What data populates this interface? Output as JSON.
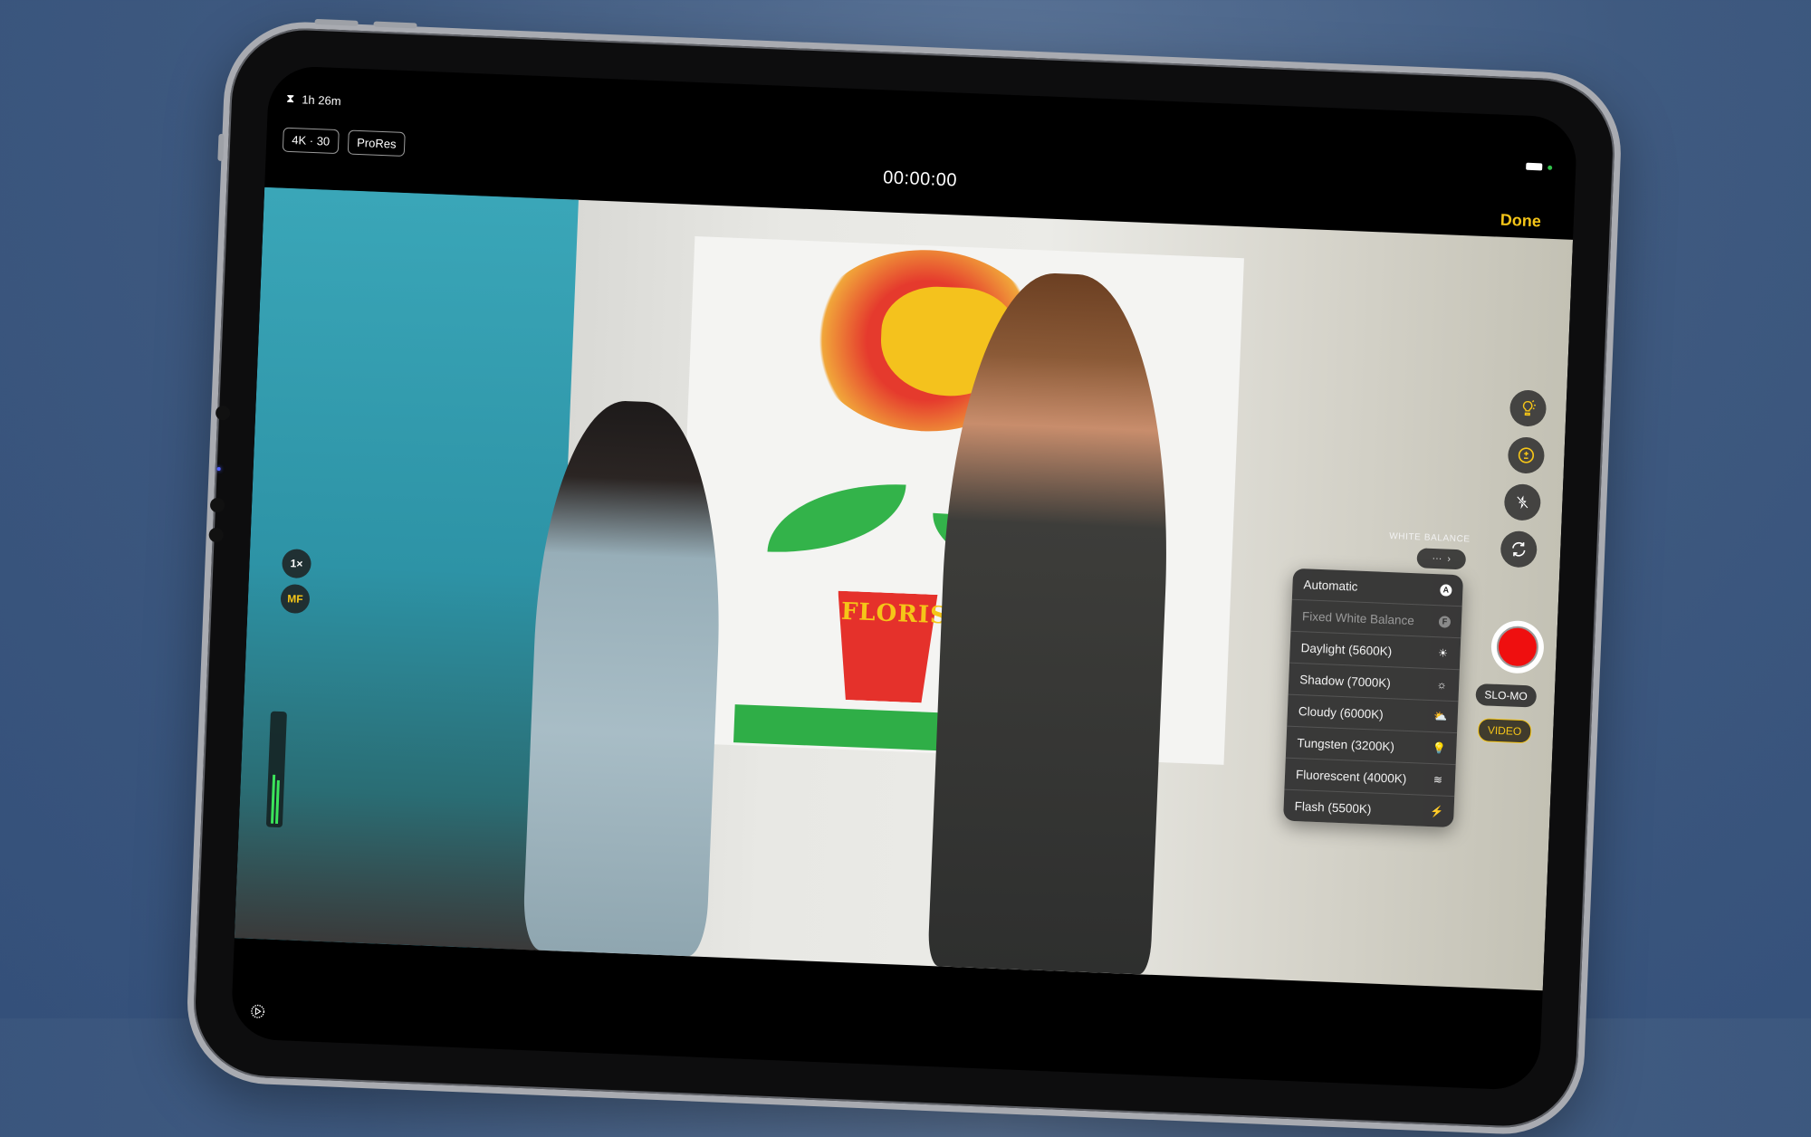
{
  "status": {
    "recording_time_remaining": "1h 26m",
    "hourglass_icon": "hourglass-icon"
  },
  "format_chips": [
    {
      "label": "4K · 30"
    },
    {
      "label": "ProRes"
    }
  ],
  "timer": "00:00:00",
  "done_label": "Done",
  "colors": {
    "accent": "#f5c518",
    "record": "#ef0f0f",
    "audio_meter": "#3be45a"
  },
  "left_controls": {
    "zoom_label": "1×",
    "focus_label": "MF"
  },
  "audio_meter": {
    "left_level": 0.45,
    "right_level": 0.4
  },
  "white_balance": {
    "title": "WHITE BALANCE",
    "button_label": "···",
    "options": [
      {
        "label": "Automatic",
        "icon": "badge-a-icon",
        "glyph": "A",
        "enabled": true
      },
      {
        "label": "Fixed White Balance",
        "icon": "badge-f-icon",
        "glyph": "F",
        "enabled": false
      },
      {
        "label": "Daylight (5600K)",
        "icon": "sun-icon",
        "glyph": "☀",
        "enabled": true
      },
      {
        "label": "Shadow (7000K)",
        "icon": "sunset-icon",
        "glyph": "☼",
        "enabled": true
      },
      {
        "label": "Cloudy (6000K)",
        "icon": "cloud-sun-icon",
        "glyph": "⛅",
        "enabled": true
      },
      {
        "label": "Tungsten (3200K)",
        "icon": "lightbulb-icon",
        "glyph": "💡",
        "enabled": true
      },
      {
        "label": "Fluorescent (4000K)",
        "icon": "cfl-bulb-icon",
        "glyph": "≋",
        "enabled": true
      },
      {
        "label": "Flash (5500K)",
        "icon": "bolt-icon",
        "glyph": "⚡",
        "enabled": true
      }
    ]
  },
  "right_controls": {
    "modes": [
      {
        "label": "SLO-MO"
      },
      {
        "label": "VIDEO",
        "selected": true
      }
    ]
  },
  "scene": {
    "poster_text": "FLORIST"
  }
}
